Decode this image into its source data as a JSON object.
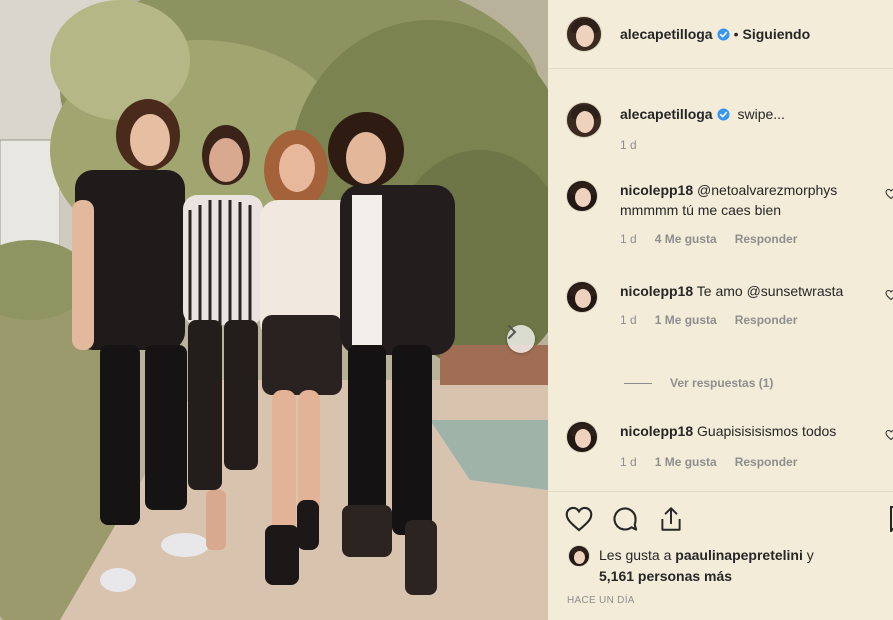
{
  "post": {
    "author": "alecapetilloga",
    "follow_status": "Siguiendo",
    "separator": "•"
  },
  "caption": {
    "author": "alecapetilloga",
    "text": "swipe...",
    "time": "1 d"
  },
  "comments": [
    {
      "author": "nicolepp18",
      "text": "@netoalvarezmorphys mmmmm tú me caes bien",
      "time": "1 d",
      "likes": "4 Me gusta",
      "reply_label": "Responder"
    },
    {
      "author": "nicolepp18",
      "text": "Te amo @sunsetwrasta",
      "time": "1 d",
      "likes": "1 Me gusta",
      "reply_label": "Responder",
      "view_replies": "Ver respuestas (1)"
    },
    {
      "author": "nicolepp18",
      "text": "Guapisisisismos todos",
      "time": "1 d",
      "likes": "1 Me gusta",
      "reply_label": "Responder"
    }
  ],
  "likes_summary": {
    "prefix": "Les gusta a ",
    "user": "paaulinapepretelini",
    "suffix": " y",
    "others": "5,161 personas más"
  },
  "timestamp": "HACE UN DÍA",
  "icons": {
    "verified": "verified-badge-icon",
    "like": "heart-icon",
    "comment": "comment-bubble-icon",
    "share": "share-upload-icon",
    "save": "bookmark-icon",
    "next": "chevron-right-icon"
  },
  "colors": {
    "panel_bg": "#f3ecd9",
    "verified_blue": "#3897f0",
    "muted_text": "#8e8e8e",
    "primary_text": "#262626"
  }
}
